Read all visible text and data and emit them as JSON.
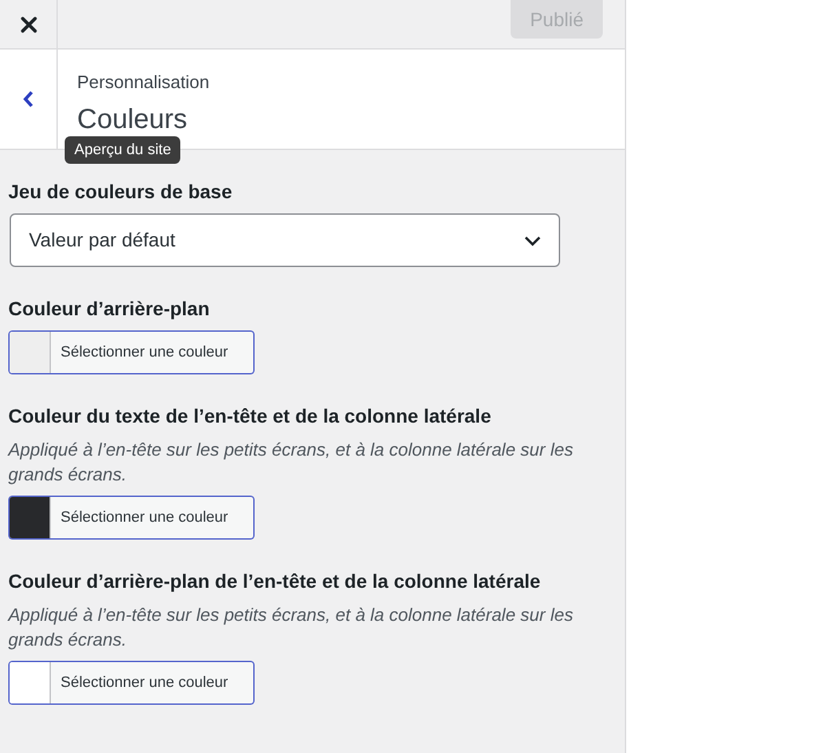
{
  "publish_button": {
    "label": "Publié",
    "disabled": true
  },
  "header": {
    "breadcrumb": "Personnalisation",
    "title": "Couleurs",
    "tooltip": "Aperçu du site"
  },
  "controls": [
    {
      "kind": "select",
      "label": "Jeu de couleurs de base",
      "value": "Valeur par défaut"
    },
    {
      "kind": "color",
      "label": "Couleur d’arrière-plan",
      "button": "Sélectionner une couleur",
      "color": "#eeeeee"
    },
    {
      "kind": "color",
      "label": "Couleur du texte de l’en-tête et de la colonne latérale",
      "description": "Appliqué à l’en-tête sur les petits écrans, et à la colonne latérale sur les grands écrans.",
      "button": "Sélectionner une couleur",
      "color": "#28292c"
    },
    {
      "kind": "color",
      "label": "Couleur d’arrière-plan de l’en-tête et de la colonne latérale",
      "description": "Appliqué à l’en-tête sur les petits écrans, et à la colonne latérale sur les grands écrans.",
      "button": "Sélectionner une couleur",
      "color": "#ffffff"
    }
  ]
}
